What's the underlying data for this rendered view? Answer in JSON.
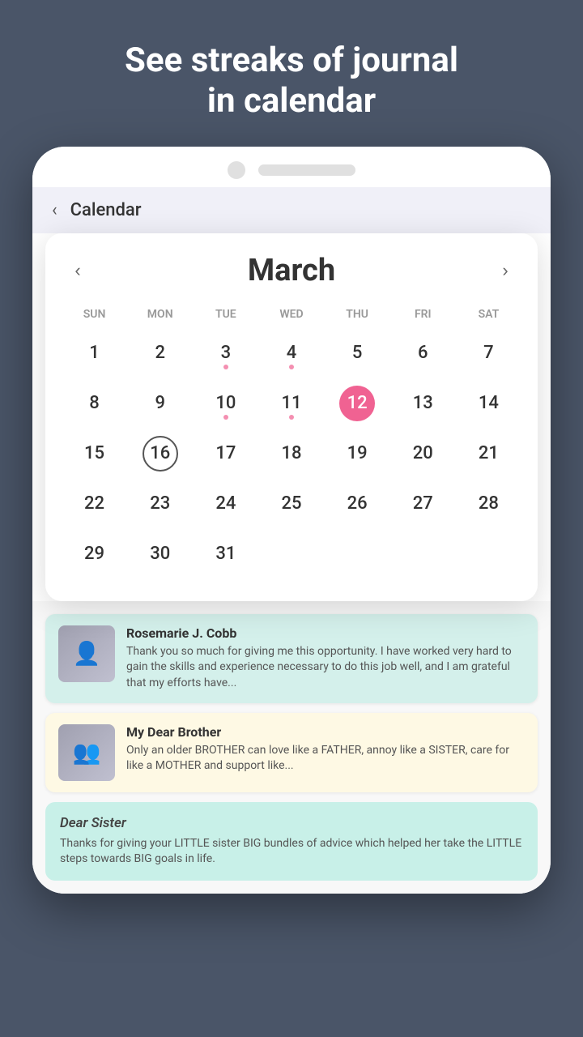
{
  "header": {
    "title_line1": "See streaks of journal",
    "title_line2": "in calendar"
  },
  "phone": {
    "camera_alt": "camera",
    "speaker_alt": "speaker"
  },
  "app_header": {
    "back_label": "‹",
    "title": "Calendar"
  },
  "calendar": {
    "month": "March",
    "prev_label": "‹",
    "next_label": "›",
    "day_headers": [
      "SUN",
      "MON",
      "TUE",
      "WED",
      "THU",
      "FRI",
      "SAT"
    ],
    "today_date": 12,
    "selected_date": 16,
    "days": [
      {
        "date": 1,
        "col": 1,
        "dot": false
      },
      {
        "date": 2,
        "col": 2,
        "dot": false
      },
      {
        "date": 3,
        "col": 3,
        "dot": true
      },
      {
        "date": 4,
        "col": 4,
        "dot": true
      },
      {
        "date": 5,
        "col": 5,
        "dot": false
      },
      {
        "date": 6,
        "col": 6,
        "dot": false
      },
      {
        "date": 7,
        "col": 7,
        "dot": false
      },
      {
        "date": 8,
        "col": 1,
        "dot": false
      },
      {
        "date": 9,
        "col": 2,
        "dot": false
      },
      {
        "date": 10,
        "col": 3,
        "dot": true
      },
      {
        "date": 11,
        "col": 4,
        "dot": true
      },
      {
        "date": 12,
        "col": 5,
        "dot": false,
        "today": true
      },
      {
        "date": 13,
        "col": 6,
        "dot": false
      },
      {
        "date": 14,
        "col": 7,
        "dot": false
      },
      {
        "date": 15,
        "col": 1,
        "dot": false
      },
      {
        "date": 16,
        "col": 2,
        "dot": false,
        "selected": true
      },
      {
        "date": 17,
        "col": 3,
        "dot": false
      },
      {
        "date": 18,
        "col": 4,
        "dot": false
      },
      {
        "date": 19,
        "col": 5,
        "dot": false
      },
      {
        "date": 20,
        "col": 6,
        "dot": false
      },
      {
        "date": 21,
        "col": 7,
        "dot": false
      },
      {
        "date": 22,
        "col": 1,
        "dot": false
      },
      {
        "date": 23,
        "col": 2,
        "dot": false
      },
      {
        "date": 24,
        "col": 3,
        "dot": false
      },
      {
        "date": 25,
        "col": 4,
        "dot": false
      },
      {
        "date": 26,
        "col": 5,
        "dot": false
      },
      {
        "date": 27,
        "col": 6,
        "dot": false
      },
      {
        "date": 28,
        "col": 7,
        "dot": false
      },
      {
        "date": 29,
        "col": 1,
        "dot": false
      },
      {
        "date": 30,
        "col": 2,
        "dot": false
      },
      {
        "date": 31,
        "col": 3,
        "dot": false
      }
    ]
  },
  "journal_entries": [
    {
      "id": "entry1",
      "author": "Rosemarie J. Cobb",
      "text": "Thank you so much for giving me this opportunity. I have worked very hard to gain the skills and experience necessary to do this job well, and I am grateful that my efforts have...",
      "card_type": "teal"
    },
    {
      "id": "entry2",
      "author": "My Dear Brother",
      "text": "Only an older BROTHER can love like a FATHER, annoy like a SISTER, care for like a MOTHER and support like...",
      "card_type": "yellow"
    }
  ],
  "single_entry": {
    "title": "Dear Sister",
    "text": "Thanks for giving your LITTLE sister BIG bundles of advice which helped her take the LITTLE steps towards BIG goals in life.",
    "card_type": "mint"
  }
}
